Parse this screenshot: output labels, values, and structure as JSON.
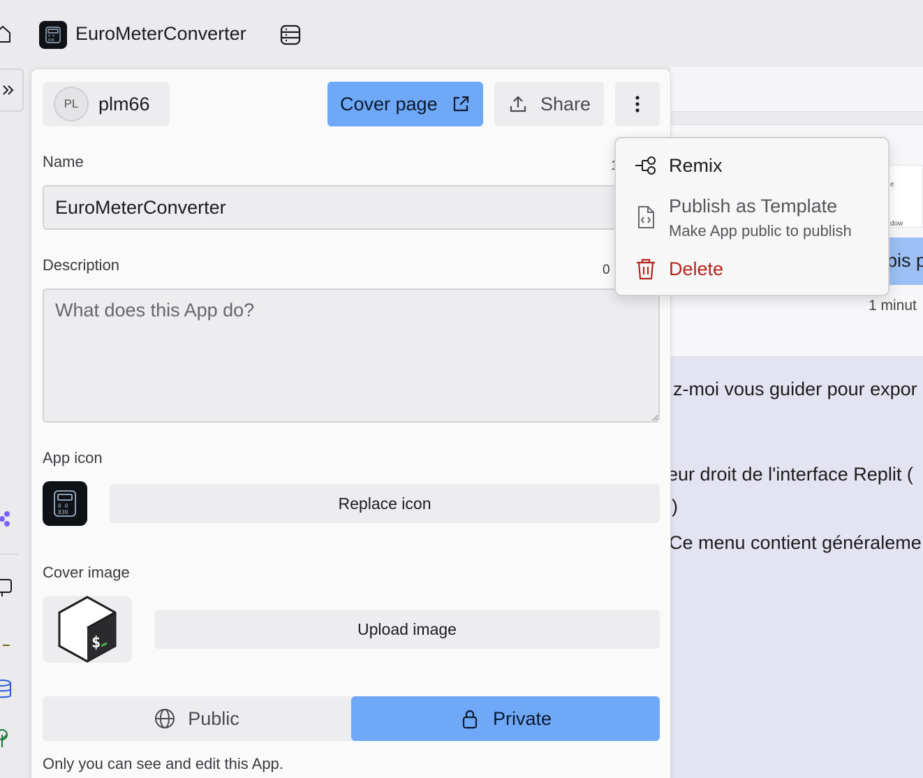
{
  "topbar": {
    "app_title": "EuroMeterConverter"
  },
  "background": {
    "thumb_text_1": "e",
    "thumb_text_2": "dow",
    "blue_snippet": "pis p",
    "time_snippet": "1 minut",
    "chat_line_1": "z-moi vous guider pour expor",
    "chat_line_2": "eur droit de l'interface Replit (",
    "chat_line_3": ")",
    "chat_line_4": "Ce menu contient généraleme"
  },
  "panel": {
    "user": {
      "initials": "PL",
      "name": "plm66"
    },
    "cover_page_label": "Cover page",
    "share_label": "Share",
    "name_label": "Name",
    "name_counter": "1",
    "name_value": "EuroMeterConverter",
    "description_label": "Description",
    "description_counter": "0",
    "description_placeholder": "What does this App do?",
    "app_icon_label": "App icon",
    "replace_icon_label": "Replace icon",
    "cover_image_label": "Cover image",
    "upload_image_label": "Upload image",
    "visibility": {
      "public_label": "Public",
      "private_label": "Private",
      "selected": "Private",
      "note": "Only you can see and edit this App."
    }
  },
  "menu": {
    "remix_label": "Remix",
    "publish_label": "Publish as Template",
    "publish_sub": "Make App public to publish",
    "delete_label": "Delete",
    "delete_color": "#b3261e"
  },
  "colors": {
    "accent_blue": "#6ea8f7",
    "chat_background": "#e4e3f1"
  }
}
